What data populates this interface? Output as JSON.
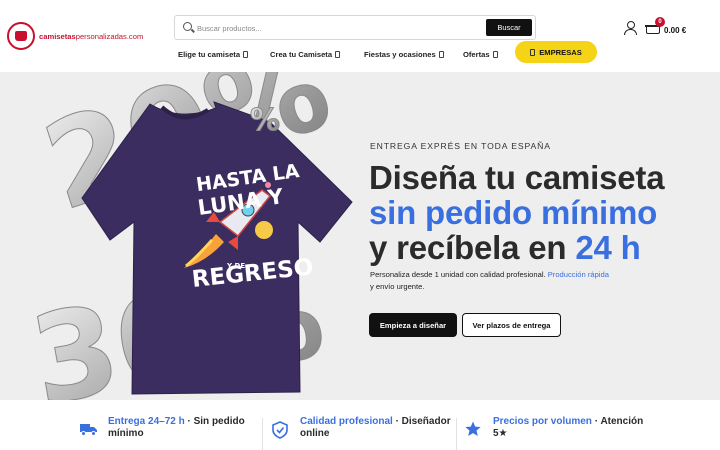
{
  "brand": {
    "logo_text_bold": "camisetas",
    "logo_text_light": "personalizadas.com"
  },
  "search": {
    "placeholder": "Buscar productos...",
    "button_label": "Buscar"
  },
  "cart": {
    "count": "0",
    "total": "0.00 €"
  },
  "nav": {
    "items": [
      {
        "label": "Elige tu camiseta"
      },
      {
        "label": "Crea tu Camiseta"
      },
      {
        "label": "Fiestas y ocasiones"
      },
      {
        "label": "Ofertas"
      }
    ],
    "empresas_label": "EMPRESAS"
  },
  "hero": {
    "eyebrow": "ENTREGA EXPRÉS EN TODA ESPAÑA",
    "headline_line1": "Diseña tu camiseta",
    "headline_line2": "sin pedido mínimo",
    "headline_line3_start": "y recíbela en ",
    "headline_line3_highlight": "24 h",
    "subtext_start": "Personaliza desde 1 unidad con calidad profesional. ",
    "subtext_link": "Producción rápida",
    "subtext_end": "y envío urgente.",
    "primary_cta": "Empieza a diseñar",
    "secondary_cta": "Ver plazos de entrega",
    "tshirt_text": {
      "line1": "HASTA LA",
      "line2": "LUNA Y",
      "line3": "Y DE",
      "line4": "REGRESO"
    },
    "balloon_top": "20%",
    "balloon_bottom": "30%"
  },
  "features": [
    {
      "title_highlight": "Entrega 24–72 h",
      "title_rest": " · Sin pedido mínimo",
      "icon": "truck-icon"
    },
    {
      "title_highlight": "Calidad profesional",
      "title_rest": " · Diseñador online",
      "icon": "shield-check-icon"
    },
    {
      "title_highlight": "Precios por volumen",
      "title_rest": " · Atención 5★",
      "icon": "star-icon"
    }
  ],
  "colors": {
    "brand_red": "#c8102e",
    "accent_blue": "#3a6fe0",
    "empresas_yellow": "#f5d418",
    "shirt_purple": "#3b2d60"
  }
}
